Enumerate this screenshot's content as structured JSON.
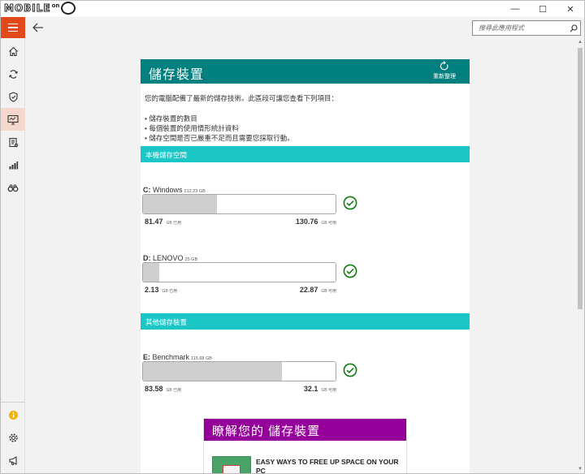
{
  "window": {
    "logo_text": "MOBILE",
    "logo_on": "on",
    "minimize": "—",
    "maximize": "☐",
    "close": "✕"
  },
  "header": {
    "search_placeholder": "搜尋此應用程式"
  },
  "sidebar": {
    "items": [
      {
        "icon": "home-icon"
      },
      {
        "icon": "sync-icon"
      },
      {
        "icon": "shield-icon"
      },
      {
        "icon": "monitor-icon",
        "active": true
      },
      {
        "icon": "document-icon"
      },
      {
        "icon": "signal-bars-icon"
      },
      {
        "icon": "binoculars-icon"
      }
    ],
    "bottom_items": [
      {
        "icon": "info-icon"
      },
      {
        "icon": "gear-icon"
      },
      {
        "icon": "megaphone-icon"
      }
    ]
  },
  "colors": {
    "accent_orange": "#e2491a",
    "title_teal": "#007f7f",
    "section_cyan": "#1ac6c6",
    "learn_purple": "#96009a",
    "check_green": "#107c10"
  },
  "main": {
    "title": "儲存裝置",
    "refresh_label": "重新整理",
    "intro": "您的電腦配備了最新的儲存技術。此區段可讓您查看下列項目：",
    "bullets": [
      "• 儲存裝置的數目",
      "• 每個裝置的使用情形統計資料",
      "• 儲存空間是否已嚴重不足而且需要您採取行動。"
    ],
    "local_section": "本機儲存空間",
    "other_section": "其他儲存裝置",
    "drives": [
      {
        "letter": "C:",
        "name": "Windows",
        "size": "212.23 GB",
        "used": "81.47",
        "used_unit": "GB 已用",
        "free": "130.76",
        "free_unit": "GB 可用",
        "used_fraction": 0.384
      },
      {
        "letter": "D:",
        "name": "LENOVO",
        "size": "25 GB",
        "used": "2.13",
        "used_unit": "GB 已用",
        "free": "22.87",
        "free_unit": "GB 可用",
        "used_fraction": 0.085
      },
      {
        "letter": "E:",
        "name": "Benchmark",
        "size": "115.68 GB",
        "used": "83.58",
        "used_unit": "GB 已用",
        "free": "32.1",
        "free_unit": "GB 可用",
        "used_fraction": 0.722
      }
    ]
  },
  "learn": {
    "title": "瞭解您的 儲存裝置",
    "article": "EASY WAYS TO FREE UP SPACE ON YOUR PC"
  }
}
